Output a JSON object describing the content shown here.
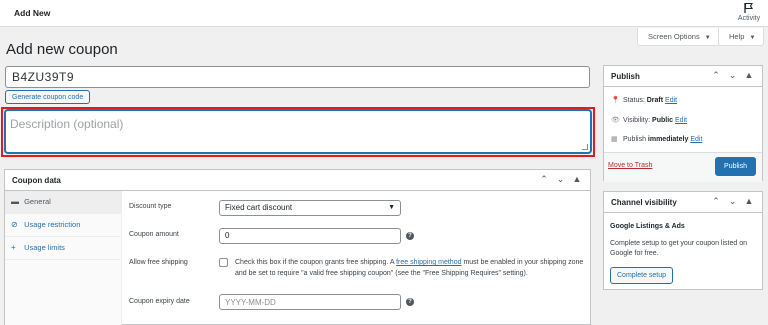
{
  "topbar": {
    "title": "Add New",
    "activity_label": "Activity"
  },
  "page_title": "Add new coupon",
  "screen_options": {
    "label": "Screen Options",
    "caret": "▼"
  },
  "help": {
    "label": "Help",
    "caret": "▼"
  },
  "coupon_code": {
    "value": "B4ZU39T9"
  },
  "generate_button": "Generate coupon code",
  "description": {
    "placeholder": "Description (optional)"
  },
  "coupon_data": {
    "title": "Coupon data",
    "controls": [
      "⌃",
      "⌄",
      "▲"
    ],
    "tabs": [
      {
        "icon": "▬",
        "label": "General"
      },
      {
        "icon": "⊘",
        "label": "Usage restriction"
      },
      {
        "icon": "+",
        "label": "Usage limits"
      }
    ],
    "discount_type": {
      "label": "Discount type",
      "value": "Fixed cart discount",
      "caret": "▼"
    },
    "coupon_amount": {
      "label": "Coupon amount",
      "value": "0"
    },
    "free_shipping": {
      "label": "Allow free shipping",
      "text_before": "Check this box if the coupon grants free shipping. A ",
      "link": "free shipping method",
      "text_after": " must be enabled in your shipping zone and be set to require \"a valid free shipping coupon\" (see the \"Free Shipping Requires\" setting)."
    },
    "expiry": {
      "label": "Coupon expiry date",
      "placeholder": "YYYY-MM-DD"
    },
    "help_glyph": "?"
  },
  "publish": {
    "title": "Publish",
    "controls": [
      "⌃",
      "⌄",
      "▲"
    ],
    "status": {
      "prefix": "Status: ",
      "value": "Draft",
      "edit": "Edit"
    },
    "visibility": {
      "prefix": "Visibility: ",
      "value": "Public",
      "edit": "Edit"
    },
    "schedule": {
      "prefix": "Publish ",
      "value": "immediately",
      "edit": "Edit"
    },
    "trash": "Move to Trash",
    "button": "Publish"
  },
  "channel": {
    "title": "Channel visibility",
    "controls": [
      "⌃",
      "⌄",
      "▲"
    ],
    "subtitle": "Google Listings & Ads",
    "text": "Complete setup to get your coupon listed on Google for free.",
    "button": "Complete setup"
  },
  "colors": {
    "accent": "#2271b1",
    "highlight": "#e21b1b",
    "danger": "#b32d2e"
  }
}
